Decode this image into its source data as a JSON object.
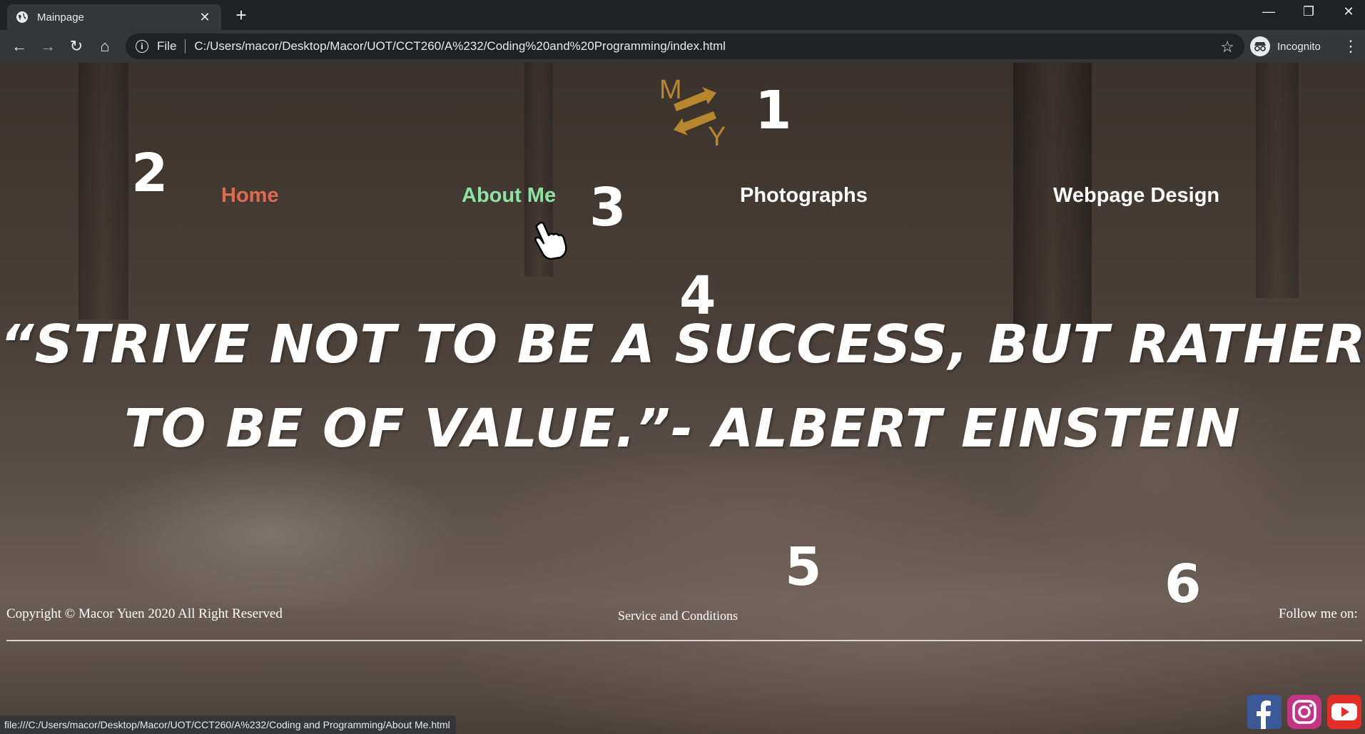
{
  "browser": {
    "tab_title": "Mainpage",
    "new_tab_symbol": "+",
    "omnibox_file_label": "File",
    "url": "C:/Users/macor/Desktop/Macor/UOT/CCT260/A%232/Coding%20and%20Programming/index.html",
    "profile_label": "Incognito",
    "status_url": "file:///C:/Users/macor/Desktop/Macor/UOT/CCT260/A%232/Coding and Programming/About Me.html"
  },
  "logo": {
    "letter_top": "M",
    "letter_bottom": "Y",
    "color": "#b8862c"
  },
  "annotations": [
    "1",
    "2",
    "3",
    "4",
    "5",
    "6"
  ],
  "nav": {
    "items": [
      {
        "label": "Home",
        "color": "#e06a4f"
      },
      {
        "label": "About Me",
        "color": "#8fe3a0"
      },
      {
        "label": "Photographs",
        "color": "#ffffff"
      },
      {
        "label": "Webpage Design",
        "color": "#ffffff"
      }
    ]
  },
  "quote": {
    "line1": "“Strive not to be a success, but rather",
    "line2": "to be of value.”- Albert Einstein"
  },
  "footer": {
    "copyright": "Copyright © Macor Yuen 2020 All Right Reserved",
    "service_link": "Service and Conditions",
    "follow_label": "Follow me on:",
    "social": [
      {
        "icon": "facebook-icon",
        "color": "#3b5998"
      },
      {
        "icon": "instagram-icon",
        "color": "#c13584"
      },
      {
        "icon": "youtube-icon",
        "color": "#e52d27"
      }
    ]
  }
}
